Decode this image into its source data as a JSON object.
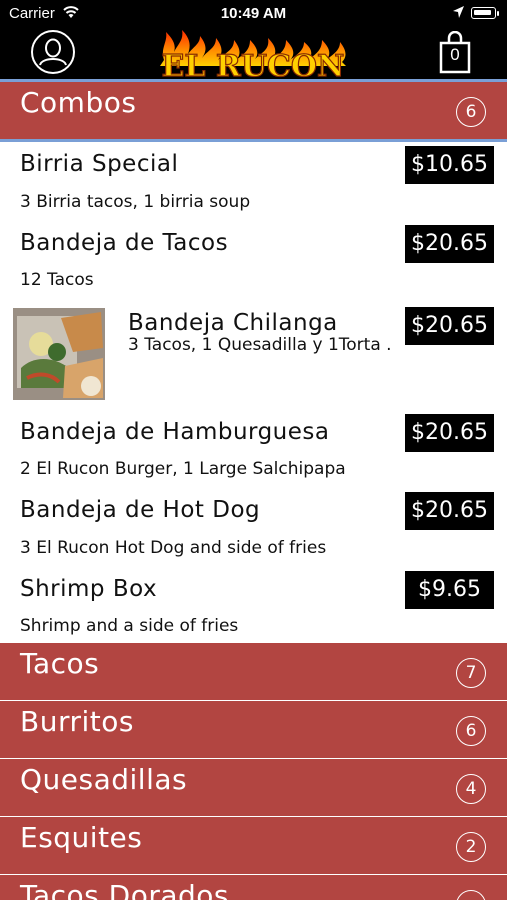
{
  "status": {
    "carrier": "Carrier",
    "time": "10:49 AM"
  },
  "header": {
    "logo_text": "EL RUCON",
    "cart_count": "0"
  },
  "categories": [
    {
      "name": "Combos",
      "count": "6"
    },
    {
      "name": "Tacos",
      "count": "7"
    },
    {
      "name": "Burritos",
      "count": "6"
    },
    {
      "name": "Quesadillas",
      "count": "4"
    },
    {
      "name": "Esquites",
      "count": "2"
    },
    {
      "name": "Tacos Dorados",
      "count": ""
    }
  ],
  "items": [
    {
      "name": "Birria Special",
      "description": "3 Birria tacos, 1 birria soup",
      "price": "$10.65"
    },
    {
      "name": "Bandeja de Tacos",
      "description": "12 Tacos",
      "price": "$20.65"
    },
    {
      "name": "Bandeja Chilanga",
      "description": "3 Tacos, 1 Quesadilla y 1Torta .",
      "price": "$20.65"
    },
    {
      "name": "Bandeja de Hamburguesa",
      "description": "2 El Rucon Burger, 1 Large Salchipapa",
      "price": "$20.65"
    },
    {
      "name": "Bandeja de Hot Dog",
      "description": "3 El Rucon Hot Dog and side of fries",
      "price": "$20.65"
    },
    {
      "name": "Shrimp Box",
      "description": "Shrimp and a side of fries",
      "price": "$9.65"
    }
  ],
  "colors": {
    "category_bg": "#b24541",
    "price_bg": "#000000",
    "accent_line": "#7a9fd6"
  }
}
